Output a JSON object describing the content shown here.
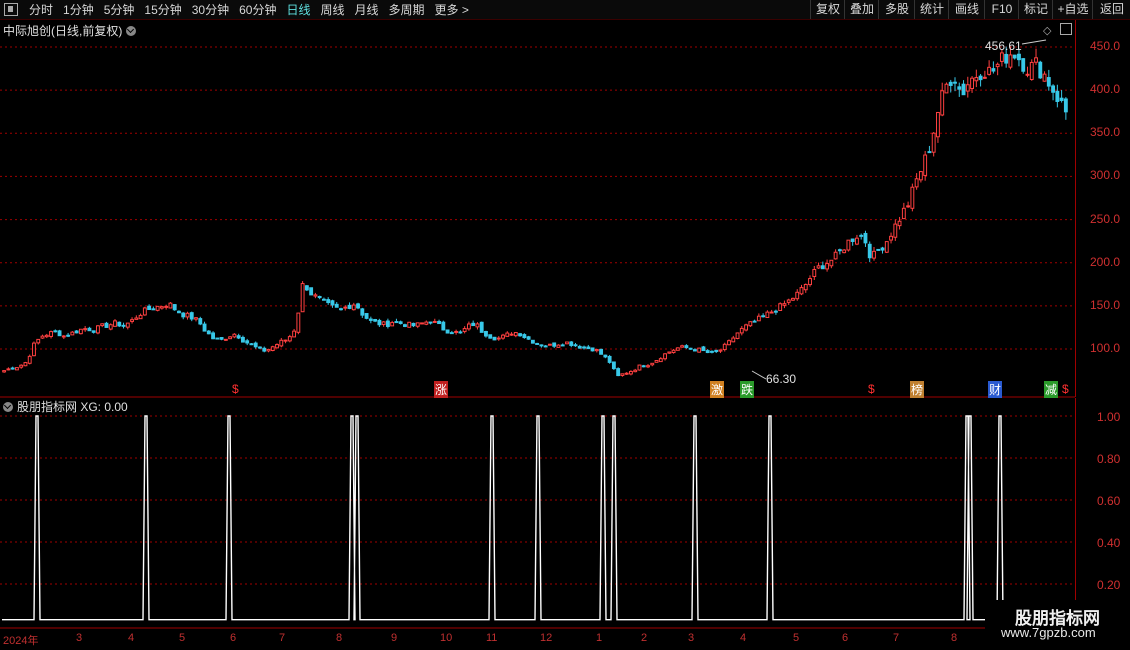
{
  "toolbar": {
    "tabs": [
      "分时",
      "1分钟",
      "5分钟",
      "15分钟",
      "30分钟",
      "60分钟",
      "日线",
      "周线",
      "月线",
      "多周期",
      "更多 >"
    ],
    "active_tab": "日线",
    "right_buttons": [
      "复权",
      "叠加",
      "多股",
      "统计",
      "画线",
      "F10",
      "标记",
      "+自选",
      "返回"
    ]
  },
  "main_panel": {
    "title": "中际旭创(日线,前复权)",
    "high_label": "456.61",
    "low_label": "66.30",
    "y_ticks": [
      "450.0",
      "400.0",
      "350.0",
      "300.0",
      "250.0",
      "200.0",
      "150.0",
      "100.0"
    ],
    "markers": [
      "$",
      "涨",
      "激",
      "跌",
      "$",
      "榜",
      "财",
      "减",
      "$"
    ]
  },
  "indicator_panel": {
    "title": "股朋指标网 XG: 0.00",
    "y_ticks": [
      "1.00",
      "0.80",
      "0.60",
      "0.40",
      "0.20"
    ]
  },
  "x_axis": {
    "labels": [
      "2024年",
      "3",
      "4",
      "5",
      "6",
      "7",
      "8",
      "9",
      "10",
      "11",
      "12",
      "1",
      "2",
      "3",
      "4",
      "5",
      "6",
      "7",
      "8"
    ]
  },
  "watermark": {
    "line1": "股朋指标网",
    "line2": "www.7gpzb.com"
  },
  "colors": {
    "up": "#ff4040",
    "down": "#38c8e8",
    "grid": "#a00000",
    "signal": "#ffffff"
  },
  "chart_data": {
    "type": "candlestick",
    "price_range": [
      66.3,
      456.61
    ],
    "y_ticks": [
      450,
      400,
      350,
      300,
      250,
      200,
      150,
      100
    ],
    "close_trajectory": [
      75,
      78,
      80,
      85,
      105,
      115,
      118,
      120,
      115,
      118,
      122,
      124,
      122,
      126,
      128,
      130,
      127,
      132,
      140,
      145,
      148,
      150,
      153,
      145,
      140,
      137,
      132,
      120,
      112,
      110,
      115,
      118,
      110,
      105,
      100,
      98,
      103,
      108,
      112,
      125,
      178,
      165,
      158,
      152,
      148,
      145,
      150,
      153,
      140,
      132,
      130,
      128,
      132,
      130,
      128,
      127,
      130,
      133,
      128,
      122,
      120,
      118,
      126,
      130,
      120,
      115,
      112,
      115,
      120,
      118,
      112,
      108,
      105,
      104,
      106,
      108,
      106,
      103,
      101,
      100,
      93,
      85,
      68,
      72,
      75,
      80,
      82,
      86,
      92,
      97,
      101,
      102,
      100,
      99,
      96,
      95,
      100,
      108,
      118,
      125,
      130,
      135,
      140,
      145,
      150,
      156,
      163,
      172,
      185,
      195,
      200,
      205,
      215,
      225,
      232,
      230,
      205,
      215,
      225,
      240,
      255,
      270,
      295,
      315,
      340,
      380,
      405,
      420,
      395,
      410,
      418,
      425,
      420,
      430,
      440,
      445,
      435,
      425,
      430,
      420,
      405,
      390,
      375
    ],
    "signals": {
      "name": "XG",
      "current": 0.0,
      "ylim": [
        0,
        1.05
      ],
      "pulse_dates": [
        "2024-01",
        "2024-03",
        "2024-05",
        "2024-07",
        "2024-07",
        "2024-09",
        "2024-10",
        "2024-11",
        "2024-11",
        "2024-12",
        "2025-02",
        "2025-03",
        "2025-07",
        "2025-07"
      ]
    }
  }
}
